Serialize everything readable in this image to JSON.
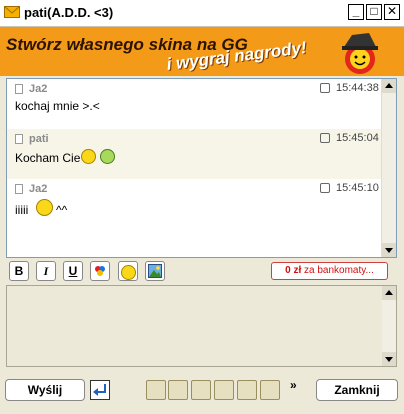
{
  "window": {
    "title": "pati(A.D.D. <3)",
    "min_glyph": "_",
    "max_glyph": "□",
    "close_glyph": "✕"
  },
  "banner": {
    "line1": "Stwórz własnego skina na GG",
    "line2": "i wygraj nagrody!"
  },
  "messages": [
    {
      "sender": "Ja2",
      "time": "15:44:38",
      "text": "kochaj mnie >.<",
      "alt": false
    },
    {
      "sender": "pati",
      "time": "15:45:04",
      "text": "Kocham Cie",
      "alt": true
    },
    {
      "sender": "Ja2",
      "time": "15:45:10",
      "text": "iiiii",
      "after": "^^",
      "alt": false
    }
  ],
  "format": {
    "bold": "B",
    "italic": "I",
    "underline": "U"
  },
  "promo": {
    "amount": "0 zł",
    "rest": "za bankomaty..."
  },
  "input": {
    "value": ""
  },
  "buttons": {
    "send": "Wyślij",
    "close": "Zamknij",
    "more": "»"
  },
  "colors": {
    "banner": "#f39a18",
    "accent_red": "#d01010"
  }
}
